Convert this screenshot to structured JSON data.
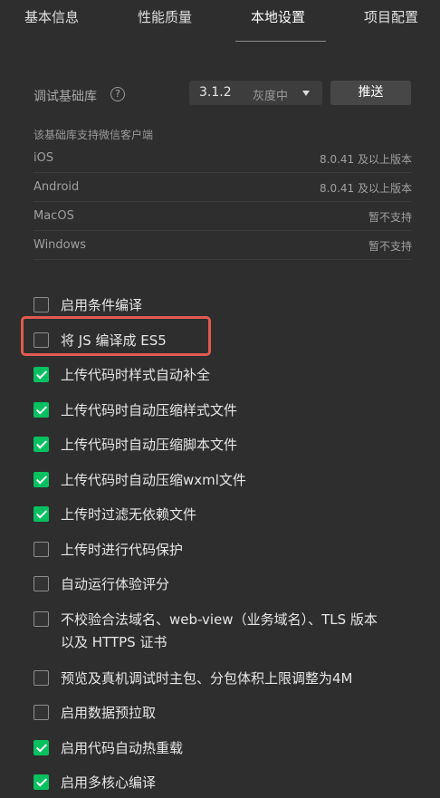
{
  "tabs": [
    {
      "label": "基本信息",
      "active": false
    },
    {
      "label": "性能质量",
      "active": false
    },
    {
      "label": "本地设置",
      "active": true
    },
    {
      "label": "项目配置",
      "active": false
    }
  ],
  "base_library": {
    "label": "调试基础库",
    "help_icon": "?",
    "version": "3.1.2",
    "status": "灰度中",
    "push_label": "推送"
  },
  "support": {
    "title": "该基础库支持微信客户端",
    "rows": [
      {
        "platform": "iOS",
        "value": "8.0.41 及以上版本"
      },
      {
        "platform": "Android",
        "value": "8.0.41 及以上版本"
      },
      {
        "platform": "MacOS",
        "value": "暂不支持"
      },
      {
        "platform": "Windows",
        "value": "暂不支持"
      }
    ]
  },
  "options": [
    {
      "label": "启用条件编译",
      "checked": false
    },
    {
      "label": "将 JS 编译成 ES5",
      "checked": false
    },
    {
      "label": "上传代码时样式自动补全",
      "checked": true
    },
    {
      "label": "上传代码时自动压缩样式文件",
      "checked": true
    },
    {
      "label": "上传代码时自动压缩脚本文件",
      "checked": true
    },
    {
      "label": "上传代码时自动压缩wxml文件",
      "checked": true
    },
    {
      "label": "上传时过滤无依赖文件",
      "checked": true
    },
    {
      "label": "上传时进行代码保护",
      "checked": false
    },
    {
      "label": "自动运行体验评分",
      "checked": false
    },
    {
      "label": "不校验合法域名、web-view（业务域名）、TLS 版本以及 HTTPS 证书",
      "checked": false
    },
    {
      "label": "预览及真机调试时主包、分包体积上限调整为4M",
      "checked": false
    },
    {
      "label": "启用数据预拉取",
      "checked": false
    },
    {
      "label": "启用代码自动热重载",
      "checked": true
    },
    {
      "label": "启用多核心编译",
      "checked": true
    }
  ],
  "colors": {
    "background": "#2e2e2e",
    "checked": "#07c160",
    "highlight": "#e25a4f"
  }
}
